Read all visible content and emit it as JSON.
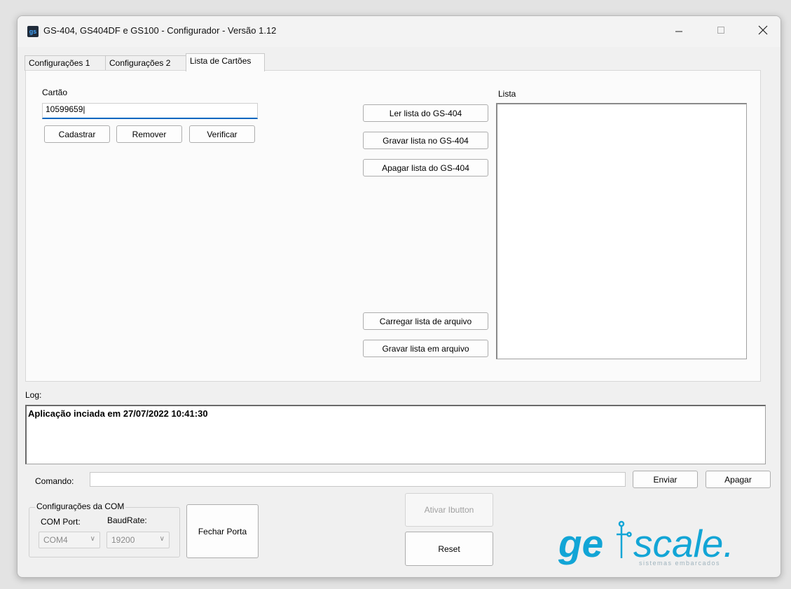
{
  "window": {
    "title": "GS-404, GS404DF e GS100 - Configurador - Versão 1.12",
    "icon_text": "gs",
    "controls": [
      "minimize-icon",
      "maximize-icon",
      "close-icon"
    ]
  },
  "tabs": [
    {
      "label": "Configurações 1",
      "active": false
    },
    {
      "label": "Configurações 2",
      "active": false
    },
    {
      "label": "Lista de Cartões",
      "active": true
    }
  ],
  "cartao": {
    "label": "Cartão",
    "value": "10599659",
    "buttons": {
      "cadastrar": "Cadastrar",
      "remover": "Remover",
      "verificar": "Verificar"
    }
  },
  "lista": {
    "label": "Lista",
    "buttons": {
      "ler": "Ler lista do GS-404",
      "gravar": "Gravar lista no GS-404",
      "apagar": "Apagar lista do GS-404",
      "carregar_arquivo": "Carregar lista de arquivo",
      "gravar_arquivo": "Gravar lista em arquivo"
    }
  },
  "log": {
    "label": "Log:",
    "lines": [
      "Aplicação inciada em 27/07/2022 10:41:30"
    ]
  },
  "comando": {
    "label": "Comando:",
    "value": "",
    "enviar": "Enviar",
    "apagar": "Apagar"
  },
  "com": {
    "group_label": "Configurações da COM",
    "port_label": "COM Port:",
    "port_value": "COM4",
    "baud_label": "BaudRate:",
    "baud_value": "19200",
    "fechar_porta": "Fechar Porta"
  },
  "actions": {
    "ativar_ibutton": "Ativar Ibutton",
    "reset": "Reset"
  },
  "logo": {
    "text_left": "ge",
    "text_right": "scale.",
    "tagline": "sistemas embarcados",
    "color": "#12a5d6"
  }
}
